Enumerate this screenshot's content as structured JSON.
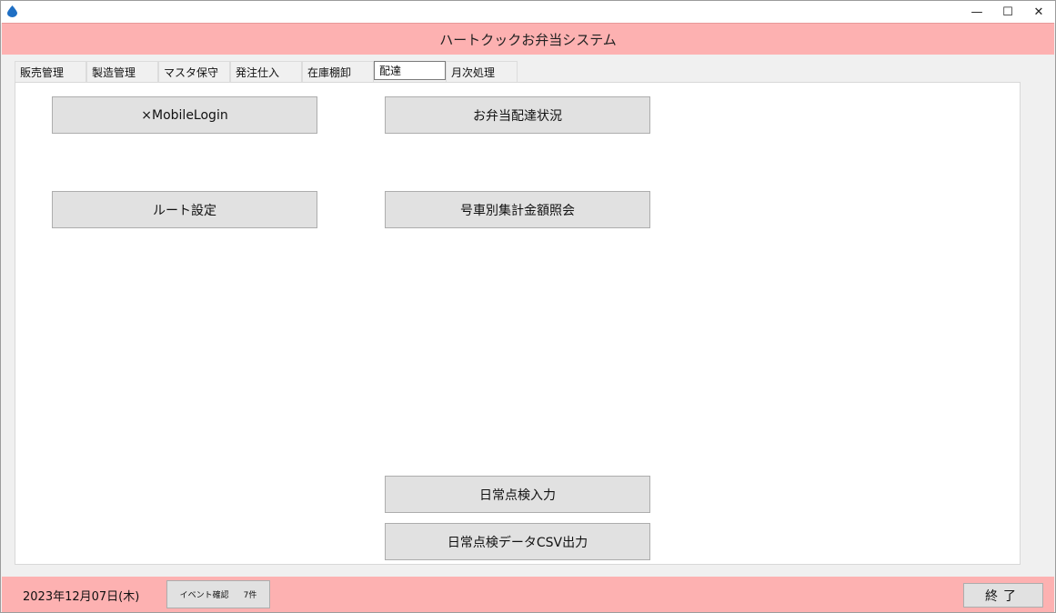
{
  "window": {
    "app_icon": "droplet-icon",
    "minimize_glyph": "—",
    "maximize_glyph": "☐",
    "close_glyph": "✕"
  },
  "header": {
    "title": "ハートクックお弁当システム"
  },
  "tabs": [
    {
      "label": "販売管理"
    },
    {
      "label": "製造管理"
    },
    {
      "label": "マスタ保守"
    },
    {
      "label": "発注仕入"
    },
    {
      "label": "在庫棚卸"
    },
    {
      "label": "配達"
    },
    {
      "label": "月次処理"
    }
  ],
  "active_tab": "配達",
  "panel": {
    "buttons": {
      "mobile_login": "×MobileLogin",
      "delivery_status": "お弁当配達状況",
      "route_setting": "ルート設定",
      "amount_inquiry": "号車別集計金額照会",
      "daily_check_input": "日常点検入力",
      "daily_check_csv": "日常点検データCSV出力"
    }
  },
  "footer": {
    "date": "2023年12月07日(木)",
    "event_label": "イベント確認",
    "event_count": "7件",
    "exit_label": "終了"
  },
  "colors": {
    "header_bg": "#fdb1b1",
    "button_bg": "#e1e1e1",
    "panel_bg": "#ffffff"
  }
}
